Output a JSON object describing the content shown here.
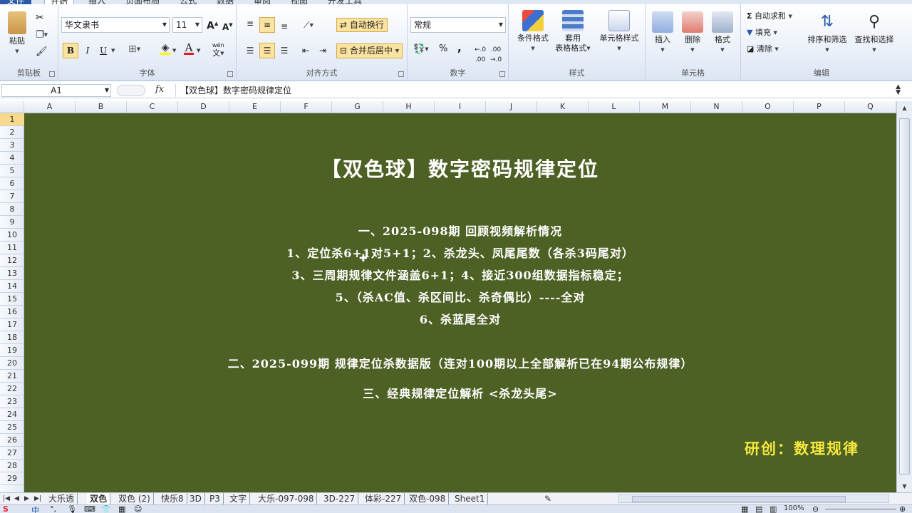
{
  "ribbon_tabs": [
    {
      "label": "文件",
      "active": false
    },
    {
      "label": "开始",
      "active": true
    },
    {
      "label": "插入",
      "active": false
    },
    {
      "label": "页面布局",
      "active": false
    },
    {
      "label": "公式",
      "active": false
    },
    {
      "label": "数据",
      "active": false
    },
    {
      "label": "审阅",
      "active": false
    },
    {
      "label": "视图",
      "active": false
    },
    {
      "label": "开发工具",
      "active": false
    }
  ],
  "clipboard": {
    "paste": "粘贴",
    "group": "剪贴板"
  },
  "font": {
    "name": "华文隶书",
    "size": "11",
    "bold": "B",
    "italic": "I",
    "underline": "U",
    "wen": "wén",
    "group": "字体"
  },
  "alignment": {
    "wrap": "自动换行",
    "merge": "合并后居中",
    "group": "对齐方式"
  },
  "number": {
    "format": "常规",
    "percent": "%",
    "comma": ",",
    "group": "数字"
  },
  "styles": {
    "conditional": "条件格式",
    "table": "套用",
    "table2": "表格格式",
    "cell": "单元格样式",
    "group": "样式"
  },
  "cells": {
    "insert": "插入",
    "delete": "删除",
    "format": "格式",
    "group": "单元格"
  },
  "editing": {
    "autosum": "自动求和",
    "fill": "填充",
    "clear": "清除",
    "sort": "排序和筛选",
    "find": "查找和选择",
    "group": "编辑"
  },
  "formula_bar": {
    "cell_ref": "A1",
    "fx": "fx",
    "content": "【双色球】数字密码规律定位"
  },
  "columns": [
    "A",
    "B",
    "C",
    "D",
    "E",
    "F",
    "G",
    "H",
    "I",
    "J",
    "K",
    "L",
    "M",
    "N",
    "O",
    "P",
    "Q"
  ],
  "rows": [
    "1",
    "2",
    "3",
    "4",
    "5",
    "6",
    "7",
    "8",
    "9",
    "10",
    "11",
    "12",
    "13",
    "14",
    "15",
    "16",
    "17",
    "18",
    "19",
    "20",
    "21",
    "22",
    "23",
    "24",
    "25",
    "26",
    "27",
    "28",
    "29"
  ],
  "content": {
    "title": "【双色球】数字密码规律定位",
    "lines": [
      "一、2025-098期  回顾视频解析情况",
      "1、定位杀6+1对5+1；2、杀龙头、凤尾尾数（各杀3码尾对）",
      "3、三周期规律文件涵盖6+1；4、接近300组数据指标稳定；",
      "5、（杀AC值、杀区间比、杀奇偶比）----全对",
      "6、杀蓝尾全对",
      "二、2025-099期  规律定位杀数据版（连对100期以上全部解析已在94期公布规律）",
      "三、经典规律定位解析  <杀龙头尾>"
    ],
    "credit": "研创：数理规律"
  },
  "sheet_tabs": [
    {
      "label": "大乐透",
      "active": false
    },
    {
      "label": "双色",
      "active": true
    },
    {
      "label": "双色 (2)",
      "active": false
    },
    {
      "label": "快乐8",
      "active": false
    },
    {
      "label": "3D",
      "active": false
    },
    {
      "label": "P3",
      "active": false
    },
    {
      "label": "文字",
      "active": false
    },
    {
      "label": "大乐-097-098",
      "active": false
    },
    {
      "label": "3D-227",
      "active": false
    },
    {
      "label": "体彩-227",
      "active": false
    },
    {
      "label": "双色-098",
      "active": false
    },
    {
      "label": "Sheet1",
      "active": false
    }
  ],
  "status": {
    "ime": "中",
    "zoom": "100%"
  },
  "colors": {
    "sheet_bg": "#4e6125",
    "title_text": "#ffffff",
    "credit_text": "#f5e73c",
    "accent": "#2a5aa8"
  }
}
